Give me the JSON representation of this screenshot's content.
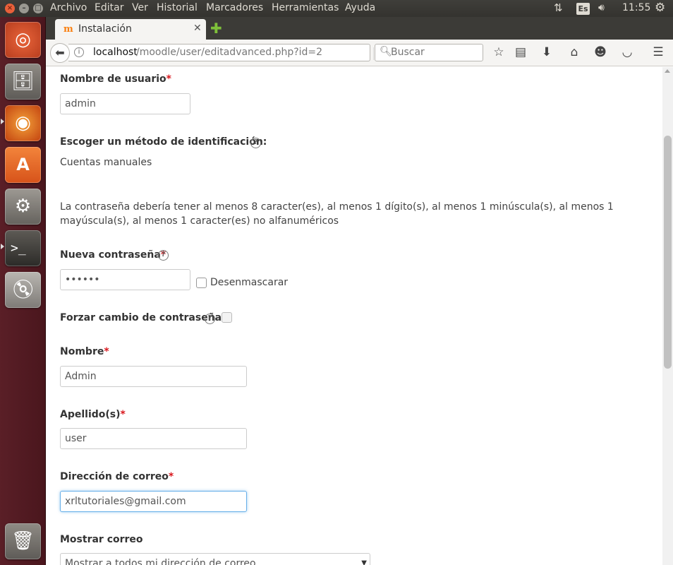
{
  "system": {
    "menu": [
      "Archivo",
      "Editar",
      "Ver",
      "Historial",
      "Marcadores",
      "Herramientas",
      "Ayuda"
    ],
    "keyboard_layout": "Es",
    "time": "11:55"
  },
  "browser": {
    "tab_title": "Instalación",
    "url_host": "localhost",
    "url_path": "/moodle/user/editadvanced.php?id=2",
    "search_placeholder": "Buscar"
  },
  "form": {
    "username": {
      "label": "Nombre de usuario",
      "value": "admin"
    },
    "auth": {
      "label": "Escoger un método de identificación:",
      "value": "Cuentas manuales"
    },
    "password_policy": "La contraseña debería tener al menos 8 caracter(es), al menos 1 dígito(s), al menos 1 minúscula(s), al menos 1 mayúscula(s), al menos 1 caracter(es) no alfanuméricos",
    "new_password": {
      "label": "Nueva contraseña",
      "value": "••••••",
      "unmask_label": "Desenmascarar"
    },
    "force_change": {
      "label": "Forzar cambio de contraseña"
    },
    "firstname": {
      "label": "Nombre",
      "value": "Admin"
    },
    "lastname": {
      "label": "Apellido(s)",
      "value": "user"
    },
    "email": {
      "label": "Dirección de correo",
      "value": "xrltutoriales@gmail.com"
    },
    "maildisplay": {
      "label": "Mostrar correo",
      "value": "Mostrar a todos mi dirección de correo"
    },
    "required_mark": "*"
  }
}
